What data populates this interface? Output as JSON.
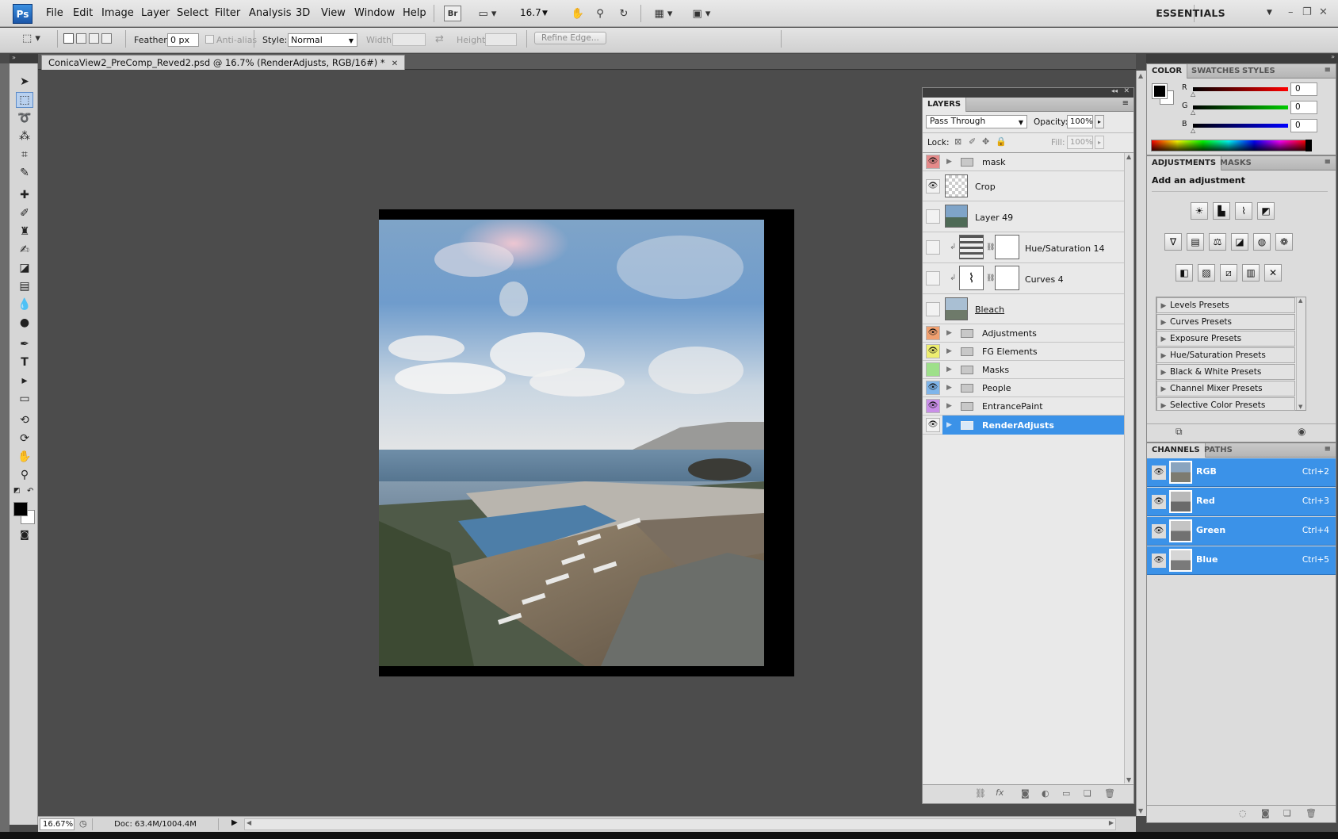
{
  "app": {
    "logo": "Ps"
  },
  "menu": [
    "File",
    "Edit",
    "Image",
    "Layer",
    "Select",
    "Filter",
    "Analysis",
    "3D",
    "View",
    "Window",
    "Help"
  ],
  "appbar": {
    "bridge": "Br",
    "zoom": "16.7",
    "workspace": "ESSENTIALS"
  },
  "options": {
    "feather_label": "Feather:",
    "feather_value": "0 px",
    "antialias_label": "Anti-alias",
    "style_label": "Style:",
    "style_value": "Normal",
    "width_label": "Width:",
    "height_label": "Height:",
    "refine_edge": "Refine Edge..."
  },
  "document": {
    "tab_title": "ConicaView2_PreComp_Reved2.psd @ 16.7% (RenderAdjusts, RGB/16#) *"
  },
  "layers_panel": {
    "tab": "LAYERS",
    "blend_mode": "Pass Through",
    "opacity_label": "Opacity:",
    "opacity_value": "100%",
    "lock_label": "Lock:",
    "fill_label": "Fill:",
    "fill_value": "100%",
    "layers": [
      {
        "name": "mask",
        "type": "group",
        "visible": true,
        "color": "#e58a8a"
      },
      {
        "name": "Crop",
        "type": "layer",
        "visible": true,
        "color": ""
      },
      {
        "name": "Layer 49",
        "type": "layer",
        "visible": false,
        "color": ""
      },
      {
        "name": "Hue/Saturation 14",
        "type": "adjustment",
        "visible": false,
        "color": ""
      },
      {
        "name": "Curves 4",
        "type": "adjustment",
        "visible": false,
        "color": ""
      },
      {
        "name": "Bleach",
        "type": "layer",
        "visible": false,
        "color": ""
      },
      {
        "name": "Adjustments",
        "type": "group",
        "visible": true,
        "color": "#f0a070"
      },
      {
        "name": "FG Elements",
        "type": "group",
        "visible": true,
        "color": "#eeee70"
      },
      {
        "name": "Masks",
        "type": "group",
        "visible": false,
        "color": "#9ee08a"
      },
      {
        "name": "People",
        "type": "group",
        "visible": true,
        "color": "#7fb5ea"
      },
      {
        "name": "EntrancePaint",
        "type": "group",
        "visible": true,
        "color": "#c98fe8"
      },
      {
        "name": "RenderAdjusts",
        "type": "group",
        "visible": true,
        "color": "",
        "selected": true
      }
    ]
  },
  "color_panel": {
    "tabs": [
      "COLOR",
      "SWATCHES",
      "STYLES"
    ],
    "channels": [
      {
        "label": "R",
        "value": "0"
      },
      {
        "label": "G",
        "value": "0"
      },
      {
        "label": "B",
        "value": "0"
      }
    ]
  },
  "adjustments_panel": {
    "tabs": [
      "ADJUSTMENTS",
      "MASKS"
    ],
    "heading": "Add an adjustment",
    "presets": [
      "Levels Presets",
      "Curves Presets",
      "Exposure Presets",
      "Hue/Saturation Presets",
      "Black & White Presets",
      "Channel Mixer Presets",
      "Selective Color Presets"
    ]
  },
  "channels_panel": {
    "tabs": [
      "CHANNELS",
      "PATHS"
    ],
    "channels": [
      {
        "name": "RGB",
        "shortcut": "Ctrl+2"
      },
      {
        "name": "Red",
        "shortcut": "Ctrl+3"
      },
      {
        "name": "Green",
        "shortcut": "Ctrl+4"
      },
      {
        "name": "Blue",
        "shortcut": "Ctrl+5"
      }
    ]
  },
  "status": {
    "zoom": "16.67%",
    "doc": "Doc: 63.4M/1004.4M"
  }
}
